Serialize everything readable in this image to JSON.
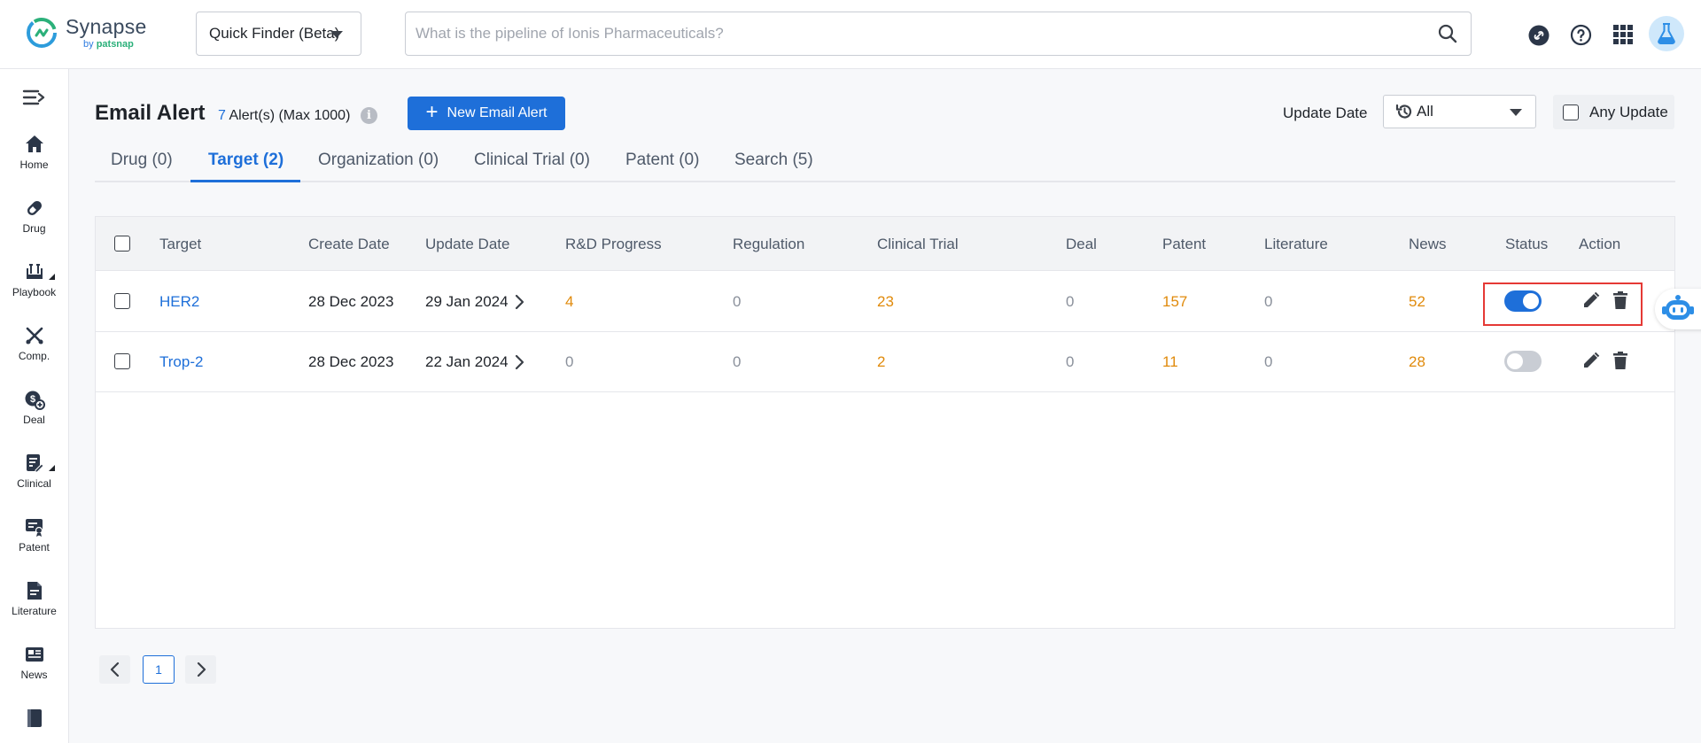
{
  "app": {
    "name": "Synapse",
    "by_prefix": "by",
    "by_brand": "patsnap"
  },
  "header": {
    "finder_label": "Quick Finder (Beta)",
    "search_placeholder": "What is the pipeline of Ionis Pharmaceuticals?",
    "icons": [
      "search-icon",
      "link-icon",
      "help-icon",
      "apps-grid-icon",
      "lab-avatar"
    ]
  },
  "sidebar": {
    "items": [
      {
        "label": "Home",
        "icon": "home-icon"
      },
      {
        "label": "Drug",
        "icon": "pill-icon"
      },
      {
        "label": "Playbook",
        "icon": "playbook-icon"
      },
      {
        "label": "Comp.",
        "icon": "competition-icon"
      },
      {
        "label": "Deal",
        "icon": "deal-icon"
      },
      {
        "label": "Clinical",
        "icon": "clinical-icon"
      },
      {
        "label": "Patent",
        "icon": "patent-icon"
      },
      {
        "label": "Literature",
        "icon": "literature-icon"
      },
      {
        "label": "News",
        "icon": "news-icon"
      },
      {
        "label": "",
        "icon": "report-icon"
      }
    ]
  },
  "page": {
    "title": "Email Alert",
    "alert_count": "7",
    "alert_count_suffix": "Alert(s) (Max 1000)",
    "new_button": "New Email Alert",
    "update_date_label": "Update Date",
    "update_date_value": "All",
    "any_update_label": "Any Update"
  },
  "tabs": [
    {
      "label": "Drug (0)",
      "active": false
    },
    {
      "label": "Target (2)",
      "active": true
    },
    {
      "label": "Organization (0)",
      "active": false
    },
    {
      "label": "Clinical Trial (0)",
      "active": false
    },
    {
      "label": "Patent (0)",
      "active": false
    },
    {
      "label": "Search (5)",
      "active": false
    }
  ],
  "table": {
    "columns": [
      "Target",
      "Create Date",
      "Update Date",
      "R&D Progress",
      "Regulation",
      "Clinical Trial",
      "Deal",
      "Patent",
      "Literature",
      "News",
      "Status",
      "Action"
    ],
    "rows": [
      {
        "target": "HER2",
        "create_date": "28 Dec 2023",
        "update_date": "29 Jan 2024",
        "rd_progress": "4",
        "regulation": "0",
        "clinical_trial": "23",
        "deal": "0",
        "patent": "157",
        "literature": "0",
        "news": "52",
        "status_on": true
      },
      {
        "target": "Trop-2",
        "create_date": "28 Dec 2023",
        "update_date": "22 Jan 2024",
        "rd_progress": "0",
        "regulation": "0",
        "clinical_trial": "2",
        "deal": "0",
        "patent": "11",
        "literature": "0",
        "news": "28",
        "status_on": false
      }
    ]
  },
  "pagination": {
    "current_page": "1"
  },
  "colors": {
    "primary": "#1e6fd9",
    "count_highlight": "#e08a0b",
    "zero_value": "#8a909b",
    "highlight_box": "#e53935"
  }
}
